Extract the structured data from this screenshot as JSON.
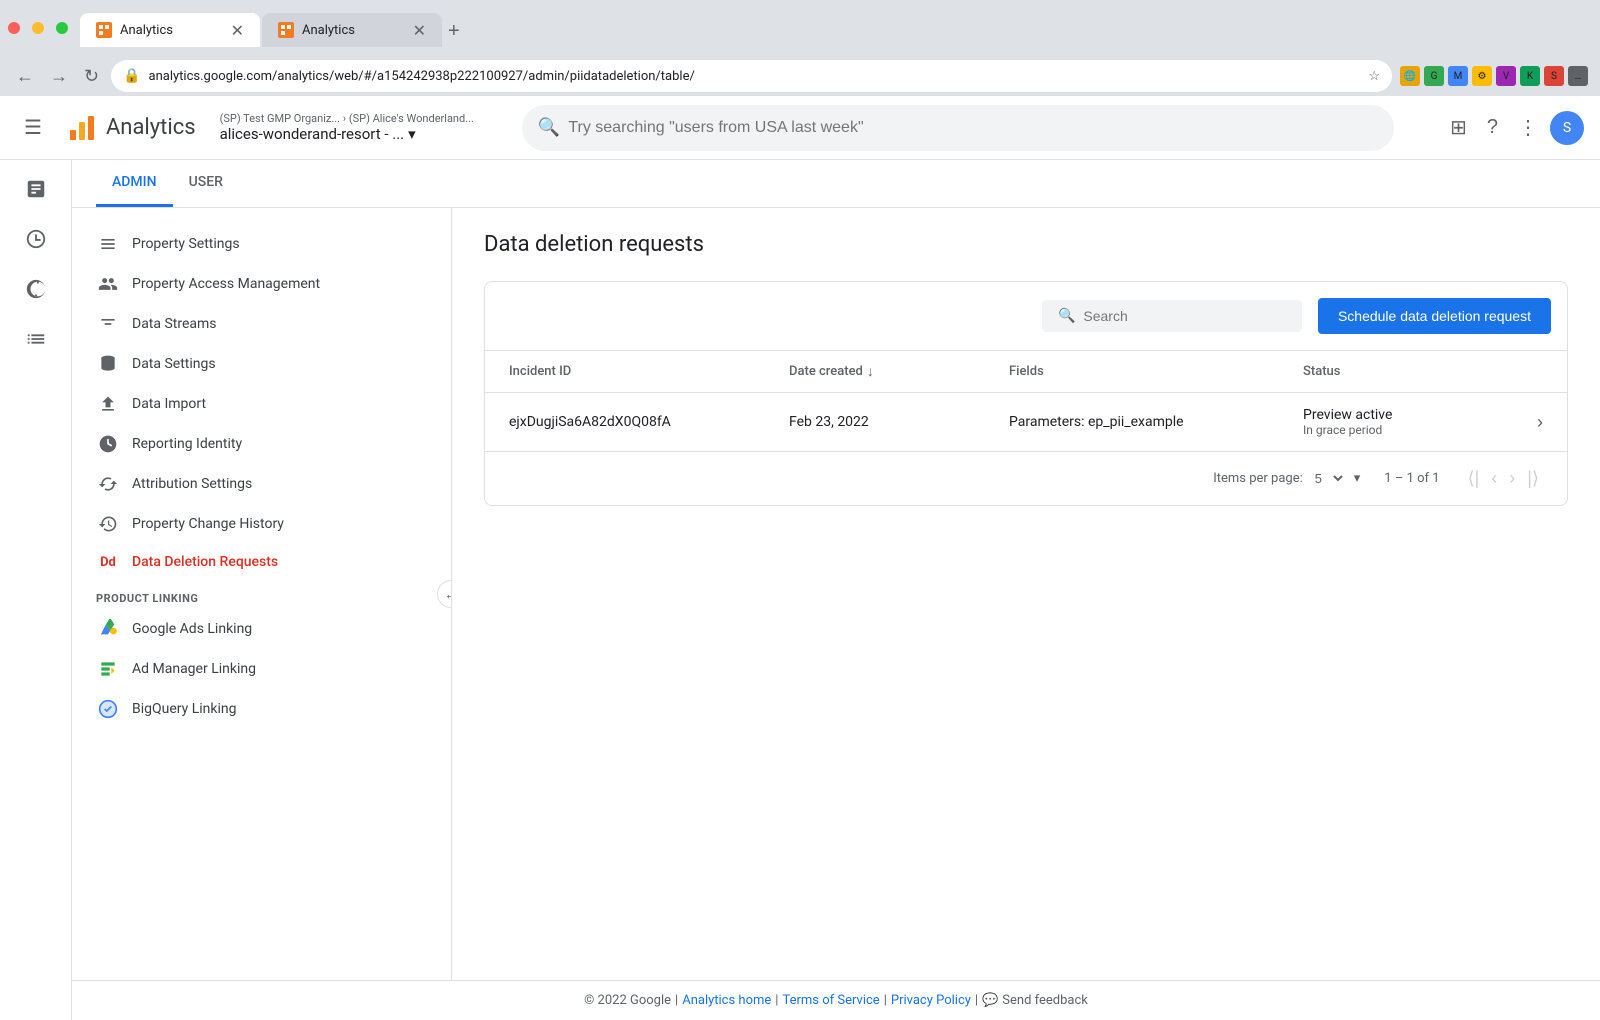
{
  "browser": {
    "tabs": [
      {
        "id": "tab1",
        "title": "Analytics",
        "url": "analytics.google.com",
        "active": true
      },
      {
        "id": "tab2",
        "title": "Analytics",
        "url": "analytics.google.com",
        "active": false
      }
    ],
    "address": "analytics.google.com/analytics/web/#/a154242938p222100927/admin/piidatadeletion/table/",
    "dots": [
      "red",
      "yellow",
      "green"
    ]
  },
  "header": {
    "app_title": "Analytics",
    "account_path": "(SP) Test GMP Organiz... › (SP) Alice's Wonderland...",
    "account_name": "alices-wonderand-resort - ...",
    "search_placeholder": "Try searching \"users from USA last week\""
  },
  "tabs": [
    {
      "id": "admin",
      "label": "ADMIN",
      "active": true
    },
    {
      "id": "user",
      "label": "USER",
      "active": false
    }
  ],
  "sidebar": {
    "items": [
      {
        "id": "property-settings",
        "label": "Property Settings",
        "icon": "settings-icon",
        "active": false
      },
      {
        "id": "property-access",
        "label": "Property Access Management",
        "icon": "group-icon",
        "active": false
      },
      {
        "id": "data-streams",
        "label": "Data Streams",
        "icon": "streams-icon",
        "active": false
      },
      {
        "id": "data-settings",
        "label": "Data Settings",
        "icon": "database-icon",
        "active": false
      },
      {
        "id": "data-import",
        "label": "Data Import",
        "icon": "upload-icon",
        "active": false
      },
      {
        "id": "reporting-identity",
        "label": "Reporting Identity",
        "icon": "identity-icon",
        "active": false
      },
      {
        "id": "attribution-settings",
        "label": "Attribution Settings",
        "icon": "attribution-icon",
        "active": false
      },
      {
        "id": "property-change-history",
        "label": "Property Change History",
        "icon": "history-icon",
        "active": false
      },
      {
        "id": "data-deletion",
        "label": "Data Deletion Requests",
        "icon": "dd-icon",
        "active": true
      }
    ],
    "product_linking_header": "PRODUCT LINKING",
    "linking_items": [
      {
        "id": "google-ads",
        "label": "Google Ads Linking",
        "icon": "ads-icon"
      },
      {
        "id": "ad-manager",
        "label": "Ad Manager Linking",
        "icon": "admanager-icon"
      },
      {
        "id": "bigquery",
        "label": "BigQuery Linking",
        "icon": "bigquery-icon"
      }
    ]
  },
  "page": {
    "title": "Data deletion requests",
    "search_placeholder": "Search",
    "schedule_btn": "Schedule data deletion request",
    "table": {
      "columns": [
        {
          "id": "incident-id",
          "label": "Incident ID",
          "sortable": false
        },
        {
          "id": "date-created",
          "label": "Date created",
          "sortable": true
        },
        {
          "id": "fields",
          "label": "Fields",
          "sortable": false
        },
        {
          "id": "status",
          "label": "Status",
          "sortable": false
        }
      ],
      "rows": [
        {
          "incident_id": "ejxDugjiSa6A82dX0Q08fA",
          "date_created": "Feb 23, 2022",
          "fields": "Parameters: ep_pii_example",
          "status_main": "Preview active",
          "status_sub": "In grace period"
        }
      ],
      "footer": {
        "items_per_page_label": "Items per page:",
        "items_per_page_value": "5",
        "pagination_info": "1 – 1 of 1"
      }
    }
  },
  "footer": {
    "copyright": "© 2022 Google",
    "links": [
      {
        "id": "analytics-home",
        "label": "Analytics home"
      },
      {
        "id": "terms",
        "label": "Terms of Service"
      },
      {
        "id": "privacy",
        "label": "Privacy Policy"
      }
    ],
    "feedback": "Send feedback"
  }
}
